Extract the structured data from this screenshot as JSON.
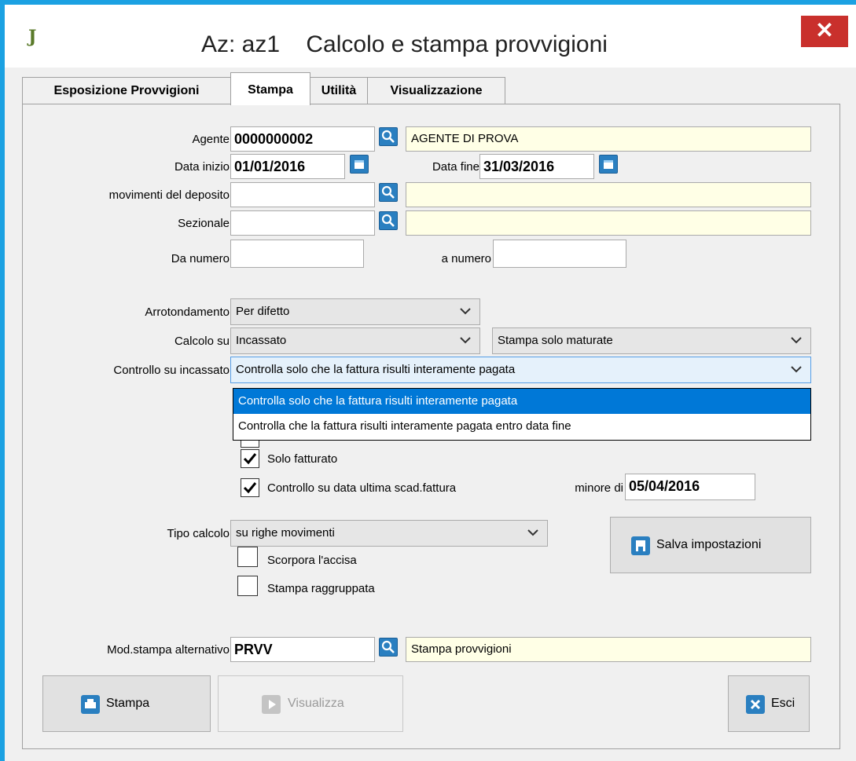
{
  "window": {
    "title": "Az: az1    Calcolo e stampa provvigioni",
    "app_icon": "J",
    "close_label": "✕"
  },
  "tabs": [
    {
      "label": "Esposizione Provvigioni",
      "active": false
    },
    {
      "label": "Stampa",
      "active": true
    },
    {
      "label": "Utilità",
      "active": false
    },
    {
      "label": "Visualizzazione",
      "active": false
    }
  ],
  "form": {
    "agente": {
      "label": "Agente",
      "value": "0000000002",
      "desc": "AGENTE DI PROVA"
    },
    "data_inizio": {
      "label": "Data inizio",
      "value": "01/01/2016"
    },
    "data_fine": {
      "label": "Data fine",
      "value": "31/03/2016"
    },
    "movimenti": {
      "label": "movimenti del deposito",
      "value": "",
      "desc": ""
    },
    "sezionale": {
      "label": "Sezionale",
      "value": "",
      "desc": ""
    },
    "da_numero": {
      "label": "Da numero",
      "value": ""
    },
    "a_numero": {
      "label": "a numero",
      "value": ""
    },
    "arrotondamento": {
      "label": "Arrotondamento",
      "value": "Per difetto"
    },
    "calcolo_su": {
      "label": "Calcolo su",
      "value": "Incassato"
    },
    "stampa_maturate": {
      "value": "Stampa solo maturate"
    },
    "controllo_incassato": {
      "label": "Controllo su incassato",
      "value": "Controlla solo che la fattura risulti interamente pagata",
      "options": [
        "Controlla solo che la fattura risulti interamente pagata",
        "Controlla che la fattura risulti interamente pagata entro data fine"
      ],
      "highlighted": 0
    },
    "solo_fatturato": {
      "label": "Solo fatturato",
      "checked": true
    },
    "controllo_scad": {
      "label": "Controllo su data ultima scad.fattura",
      "checked": true
    },
    "minore_di": {
      "label": "minore di",
      "value": "05/04/2016"
    },
    "tipo_calcolo": {
      "label": "Tipo calcolo",
      "value": "su righe movimenti"
    },
    "scorpora": {
      "label": "Scorpora l'accisa",
      "checked": false
    },
    "raggruppata": {
      "label": "Stampa raggruppata",
      "checked": false
    },
    "mod_stampa": {
      "label": "Mod.stampa alternativo",
      "value": "PRVV",
      "desc": "Stampa provvigioni"
    }
  },
  "buttons": {
    "salva": "Salva impostazioni",
    "stampa": "Stampa",
    "visualizza": "Visualizza",
    "esci": "Esci"
  },
  "colors": {
    "accent": "#0078d7",
    "readonly_bg": "#ffffe6",
    "close_bg": "#c9302c",
    "frame": "#1ba1e2"
  },
  "icons": {
    "lookup": "search-icon",
    "date": "calendar-icon",
    "check": "check-icon"
  }
}
